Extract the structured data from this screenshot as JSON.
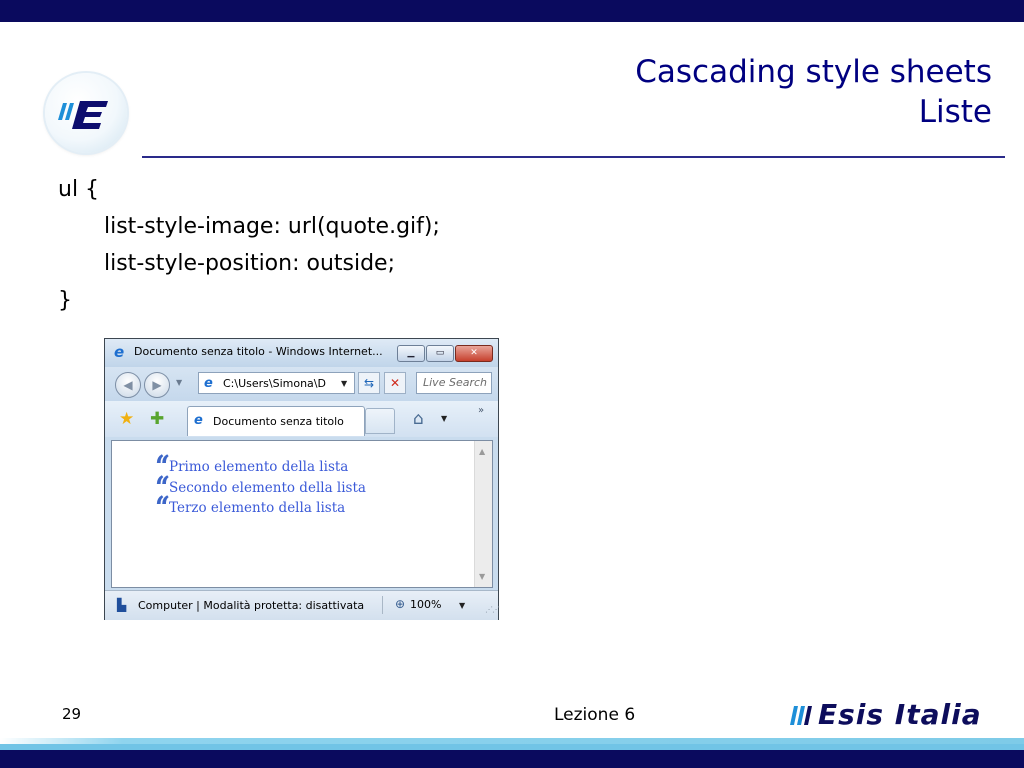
{
  "slide": {
    "title_line1": "Cascading style sheets",
    "title_line2": "Liste",
    "code": [
      "ul {",
      "list-style-image: url(quote.gif);",
      "list-style-position: outside;",
      "}"
    ],
    "page_number": "29",
    "footer_center": "Lezione 6",
    "logo_text": "Esis Italia",
    "colors": {
      "title": "#000080",
      "dark_band": "#0a0a5e",
      "light_band": "#7ecbe8",
      "list_link": "#3b5ad8"
    }
  },
  "browser": {
    "window_title": "Documento senza titolo - Windows Internet...",
    "address": "C:\\Users\\Simona\\D",
    "search_placeholder": "Live Search",
    "tab_label": "Documento senza titolo",
    "list_items": [
      "Primo elemento della lista",
      "Secondo elemento della lista",
      "Terzo elemento della lista"
    ],
    "status_text": "Computer | Modalità protetta: disattivata",
    "zoom": "100%",
    "icons": {
      "app": "ie-logo-icon",
      "back": "back-arrow-icon",
      "forward": "forward-arrow-icon",
      "refresh": "refresh-icon",
      "stop": "stop-icon",
      "favorites": "star-icon",
      "add_favorite": "add-favorite-icon",
      "home": "home-icon",
      "bullet": "quote-icon"
    }
  }
}
